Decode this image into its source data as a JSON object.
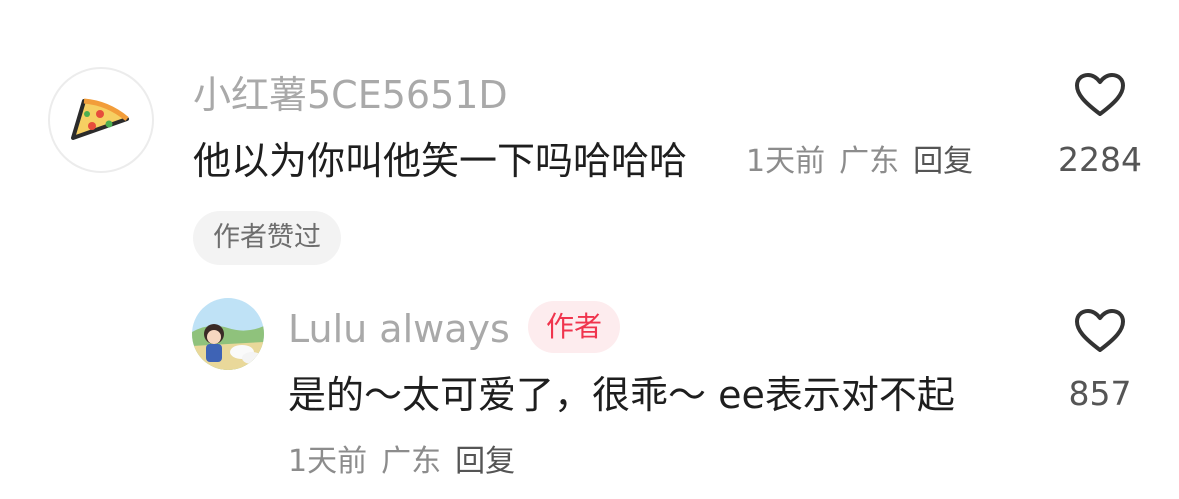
{
  "comment": {
    "username": "小红薯5CE5651D",
    "text": "他以为你叫他笑一下吗哈哈哈",
    "time": "1天前",
    "location": "广东",
    "reply_label": "回复",
    "like_count": "2284",
    "author_liked_tag": "作者赞过"
  },
  "reply": {
    "username": "Lulu always",
    "author_badge": "作者",
    "text": "是的～太可爱了，很乖～ ee表示对不起",
    "time": "1天前",
    "location": "广东",
    "reply_label": "回复",
    "like_count": "857"
  },
  "icons": {
    "main_avatar": "pizza-slice-icon",
    "like": "heart-outline-icon"
  },
  "colors": {
    "author_badge_text": "#f0344d",
    "author_badge_bg": "#fdecee"
  }
}
